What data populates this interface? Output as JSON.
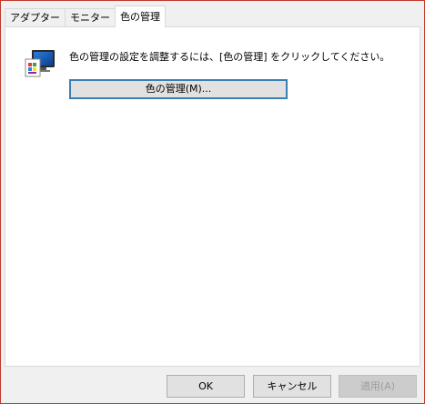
{
  "tabs": [
    {
      "label": "アダプター",
      "active": false
    },
    {
      "label": "モニター",
      "active": false
    },
    {
      "label": "色の管理",
      "active": true
    }
  ],
  "panel": {
    "icon": "color-monitor-icon",
    "description": "色の管理の設定を調整するには、[色の管理] をクリックしてください。",
    "color_management_button": "色の管理(M)..."
  },
  "footer": {
    "ok": "OK",
    "cancel": "キャンセル",
    "apply": "適用(A)"
  },
  "colors": {
    "focus_border": "#3c7fb1",
    "frame_border": "#c0392b"
  }
}
